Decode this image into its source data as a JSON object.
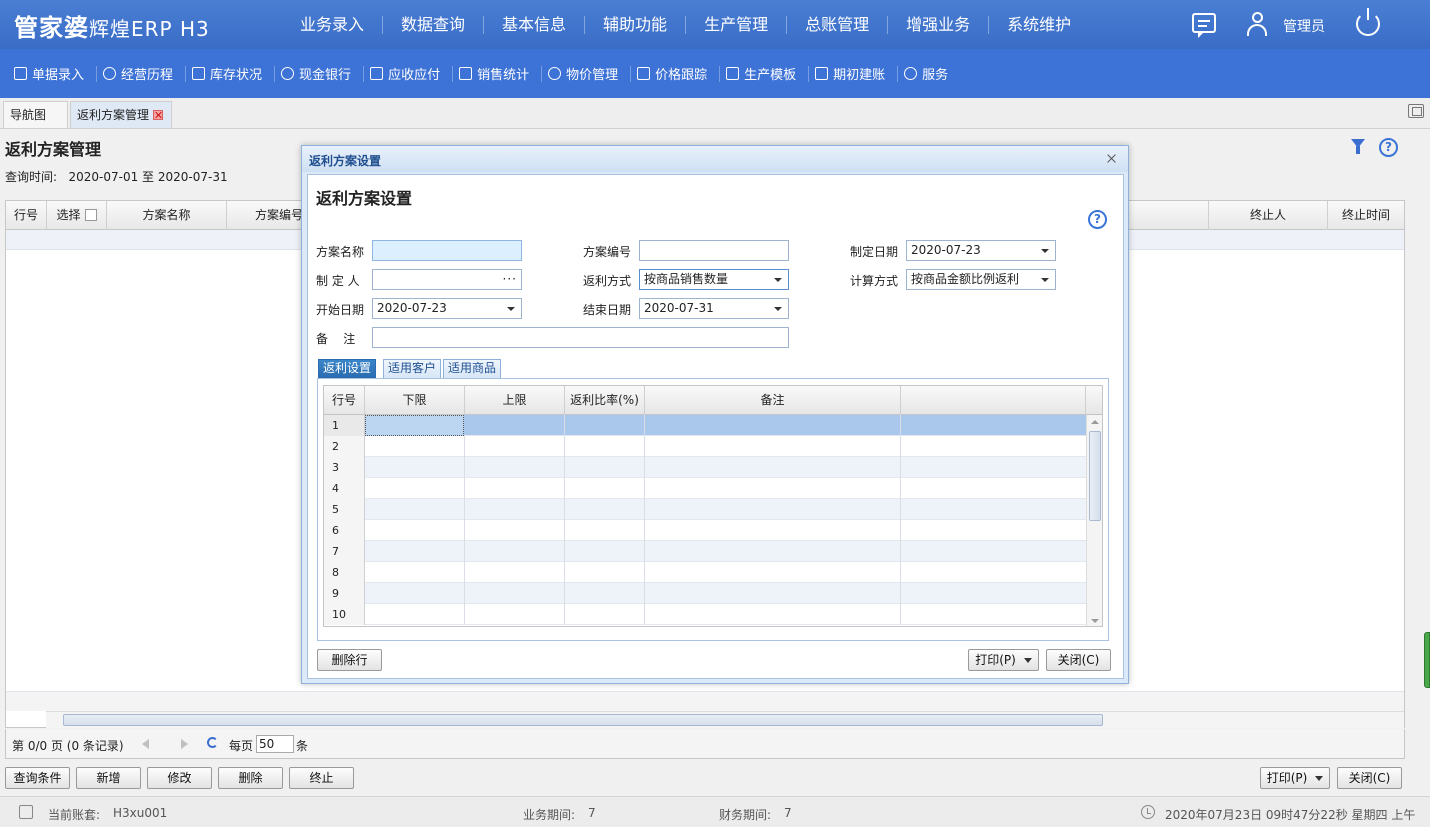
{
  "app": {
    "logo_main": "管家婆",
    "logo_sub": "辉煌ERP H3",
    "nav": [
      "业务录入",
      "数据查询",
      "基本信息",
      "辅助功能",
      "生产管理",
      "总账管理",
      "增强业务",
      "系统维护"
    ],
    "user": "管理员"
  },
  "toolbar": {
    "items": [
      "单据录入",
      "经营历程",
      "库存状况",
      "现金银行",
      "应收应付",
      "销售统计",
      "物价管理",
      "价格跟踪",
      "生产模板",
      "期初建账",
      "服务"
    ]
  },
  "tabs": [
    "导航图",
    "返利方案管理"
  ],
  "page": {
    "title": "返利方案管理",
    "query_label": "查询时间:",
    "query_range": "2020-07-01 至 2020-07-31",
    "columns": [
      "行号",
      "选择",
      "方案名称",
      "方案编号",
      "终止人",
      "终止时间"
    ]
  },
  "pager": {
    "text": "第 0/0 页 (0 条记录)",
    "per_page_label": "每页",
    "per_page": "50",
    "unit": "条"
  },
  "bottom_buttons": [
    "查询条件",
    "新增",
    "修改",
    "删除",
    "终止"
  ],
  "bottom_right_buttons": {
    "print": "打印(P)",
    "close": "关闭(C)"
  },
  "status": {
    "account_label": "当前账套:",
    "account": "H3xu001",
    "business_period_label": "业务期间:",
    "business_period": "7",
    "finance_period_label": "财务期间:",
    "finance_period": "7",
    "datetime": "2020年07月23日 09时47分22秒 星期四 上午"
  },
  "dialog": {
    "window_title": "返利方案设置",
    "heading": "返利方案设置",
    "fields": {
      "plan_name": {
        "label": "方案名称",
        "value": ""
      },
      "plan_no": {
        "label": "方案编号",
        "value": ""
      },
      "create_date": {
        "label": "制定日期",
        "value": "2020-07-23"
      },
      "creator": {
        "label": "制 定 人",
        "value": ""
      },
      "rebate_mode": {
        "label": "返利方式",
        "value": "按商品销售数量"
      },
      "calc_mode": {
        "label": "计算方式",
        "value": "按商品金额比例返利"
      },
      "start_date": {
        "label": "开始日期",
        "value": "2020-07-23"
      },
      "end_date": {
        "label": "结束日期",
        "value": "2020-07-31"
      },
      "remark": {
        "label": "备    注",
        "value": ""
      }
    },
    "tabs": [
      "返利设置",
      "适用客户",
      "适用商品"
    ],
    "grid_columns": [
      "行号",
      "下限",
      "上限",
      "返利比率(%)",
      "备注",
      ""
    ],
    "grid_rows": [
      "1",
      "2",
      "3",
      "4",
      "5",
      "6",
      "7",
      "8",
      "9",
      "10"
    ],
    "buttons": {
      "delete_row": "删除行",
      "print": "打印(P)",
      "close": "关闭(C)"
    }
  }
}
